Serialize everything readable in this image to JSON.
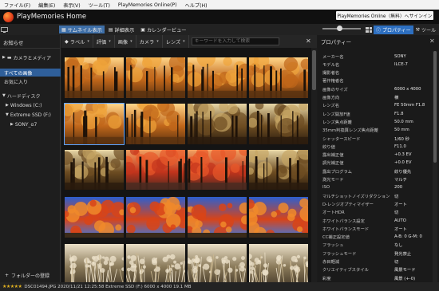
{
  "menubar": {
    "items": [
      {
        "label": "ファイル(F)"
      },
      {
        "label": "編集(E)"
      },
      {
        "label": "表示(V)"
      },
      {
        "label": "ツール(T)"
      },
      {
        "label": "PlayMemories Online(P)"
      },
      {
        "label": "ヘルプ(H)"
      }
    ]
  },
  "titlebar": {
    "app_title": "PlayMemories Home",
    "online_button": "PlayMemories Online（無料）へサインイン"
  },
  "toolbar": {
    "views": [
      {
        "label": "サムネイル表示",
        "active": true
      },
      {
        "label": "詳細表示",
        "active": false
      },
      {
        "label": "カレンダービュー",
        "active": false
      }
    ],
    "zoom_level": 0.42,
    "properties_tab": "プロパティー",
    "tools_tab": "ツール"
  },
  "sidebar": {
    "notice": "お知らせ",
    "camera_media": "カメラとメディア",
    "all_images": "すべての画像",
    "favorites": "お気に入り",
    "hard_disk": "ハードディスク",
    "windows_drive": "Windows (C:)",
    "ssd_drive": "Extreme SSD (F:)",
    "folder": "SONY_α7",
    "add_folder": "フォルダーの登録"
  },
  "filterbar": {
    "label": "ラベル",
    "rating": "評価",
    "image": "画像",
    "camera": "カメラ",
    "lens": "レンズ",
    "search_placeholder": "キーワードを入力して検索"
  },
  "grid": {
    "rows": [
      {
        "theme": "autumn",
        "tiles": [
          "autumn-1",
          "autumn-2",
          "autumn-3",
          "autumn-4"
        ]
      },
      {
        "theme": "autumn",
        "tiles": [
          "autumn-5",
          "autumn-6",
          "forest-1",
          "forest-2"
        ]
      },
      {
        "theme": "forest",
        "tiles": [
          "forest-3",
          "red-1",
          "red-2",
          "forest-4"
        ]
      },
      {
        "theme": "sky",
        "tiles": [
          "sky-1",
          "sky-2",
          "sky-3",
          "sky-4"
        ]
      },
      {
        "theme": "grass",
        "tiles": [
          "grass-1",
          "grass-2",
          "grass-3",
          "grass-4"
        ]
      }
    ],
    "selected_index": 4
  },
  "properties": {
    "title": "プロパティー",
    "rows": [
      {
        "key": "メーカー名",
        "value": "SONY"
      },
      {
        "key": "モデル名",
        "value": "ILCE-7"
      },
      {
        "key": "撮影者名",
        "value": ""
      },
      {
        "key": "著作権者名",
        "value": ""
      },
      {
        "key": "画像のサイズ",
        "value": "6000 x 4000"
      },
      {
        "key": "画像方向",
        "value": "横"
      },
      {
        "key": "レンズ名",
        "value": "FE 50mm F1.8"
      },
      {
        "key": "レンズ開放F値",
        "value": "F1.8"
      },
      {
        "key": "レンズ焦点距離",
        "value": "50.0 mm"
      },
      {
        "key": "35mm判換算レンズ焦点距離",
        "value": "50 mm"
      },
      {
        "key": "シャッタースピード",
        "value": "1/60 秒"
      },
      {
        "key": "絞り値",
        "value": "F11.0"
      },
      {
        "key": "露出補正値",
        "value": "+0.3 EV"
      },
      {
        "key": "調光補正値",
        "value": "+0.0 EV"
      },
      {
        "key": "露出プログラム",
        "value": "絞り優先"
      },
      {
        "key": "測光モード",
        "value": "マルチ"
      },
      {
        "key": "ISO",
        "value": "200"
      },
      {
        "key": "マルチショットノイズリダクション",
        "value": "切"
      },
      {
        "key": "D-レンジオプティマイザー",
        "value": "オート"
      },
      {
        "key": "オートHDR",
        "value": "切"
      },
      {
        "key": "ホワイトバランス設定",
        "value": "AUTO"
      },
      {
        "key": "ホワイトバランスモード",
        "value": "オート"
      },
      {
        "key": "CC補正設定値",
        "value": "A-B: 0 G-M: 0"
      },
      {
        "key": "フラッシュ",
        "value": "なし"
      },
      {
        "key": "フラッシュモード",
        "value": "発光禁止"
      },
      {
        "key": "赤目軽減",
        "value": "切"
      },
      {
        "key": "クリエイティブスタイル",
        "value": "風景モード"
      },
      {
        "key": "彩度",
        "value": "風景 (+-0)"
      }
    ]
  },
  "statusbar": {
    "rating_stars": "★★★★★",
    "text": "DSC01494.JPG  2020/11/21 12:25:58  Extreme SSD (F:)  6000 x 4000  19.1 MB"
  },
  "colors": {
    "accent": "#2d6fc0",
    "selection": "#2f5f9a",
    "background": "#1b1b1b"
  }
}
